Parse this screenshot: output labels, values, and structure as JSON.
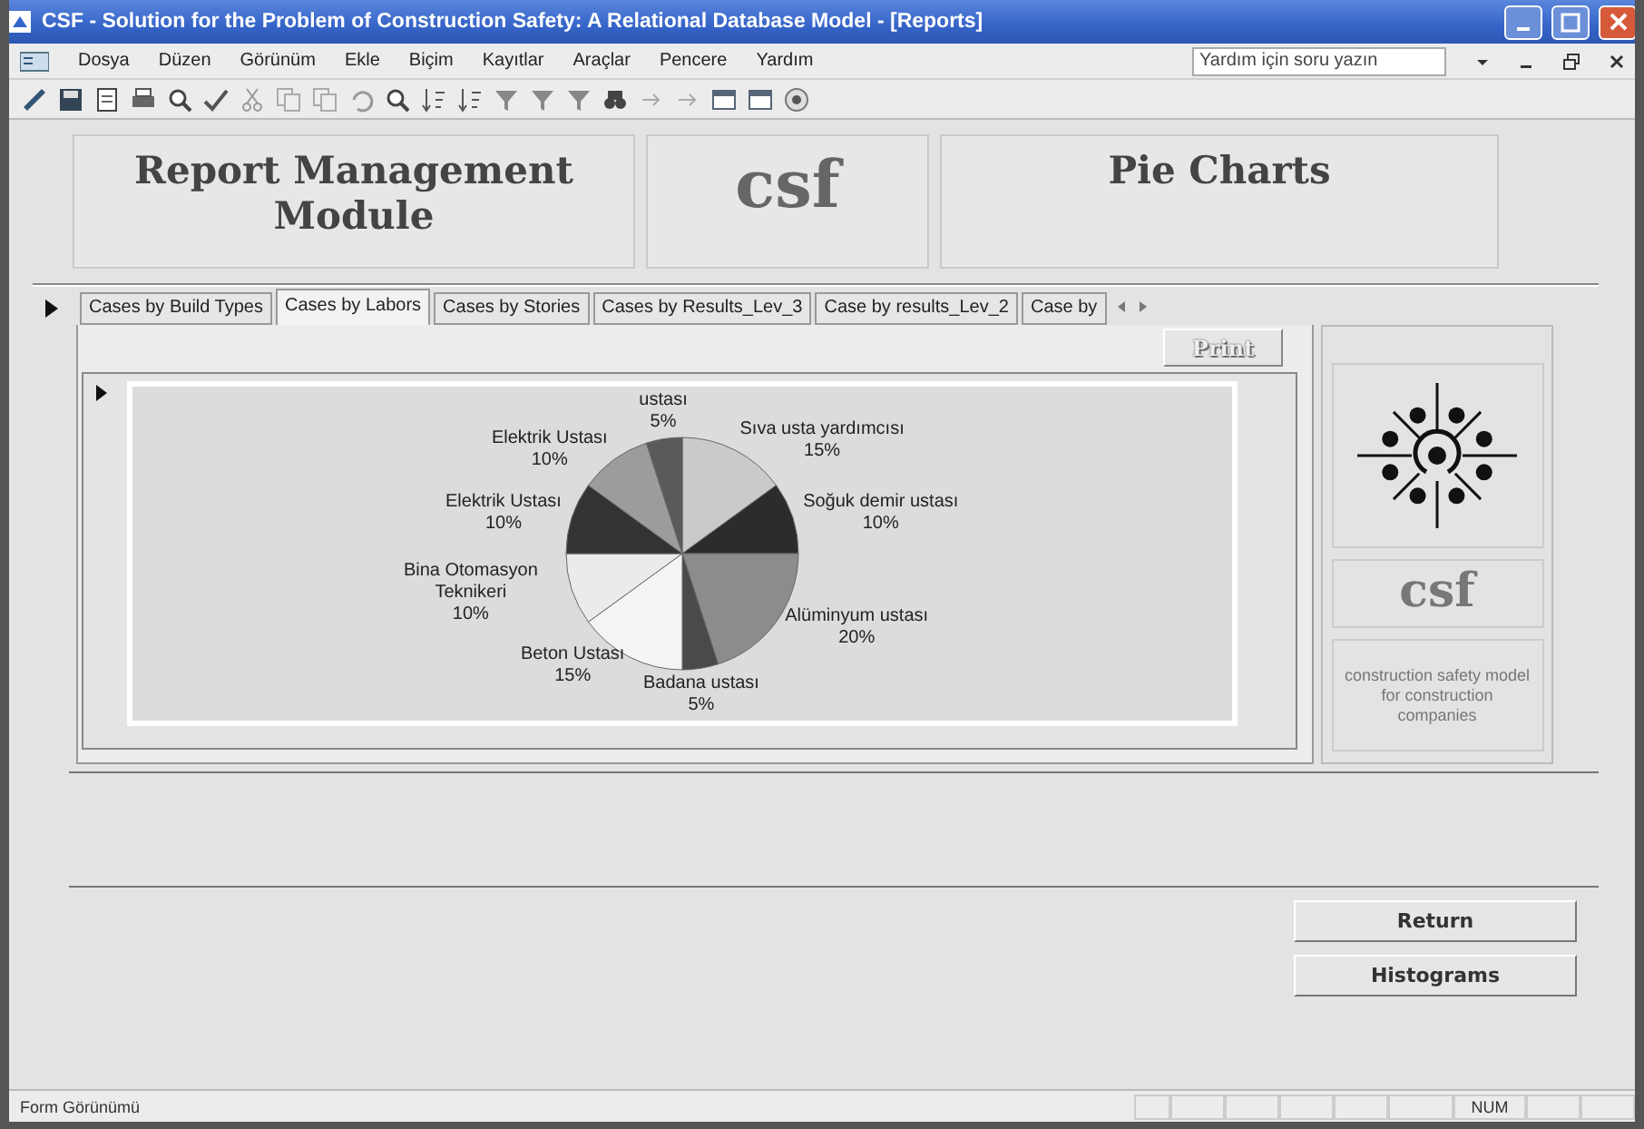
{
  "window": {
    "title": "CSF - Solution for the Problem of Construction Safety: A Relational Database Model - [Reports]"
  },
  "menu": [
    "Dosya",
    "Düzen",
    "Görünüm",
    "Ekle",
    "Biçim",
    "Kayıtlar",
    "Araçlar",
    "Pencere",
    "Yardım"
  ],
  "help_box": {
    "placeholder": "Yardım için soru yazın"
  },
  "header": {
    "module_title": "Report Management Module",
    "logo_text": "csf",
    "page_title": "Pie Charts"
  },
  "tabs": [
    {
      "label": "Cases by Build Types",
      "selected": false
    },
    {
      "label": "Cases by Labors",
      "selected": true
    },
    {
      "label": "Cases by Stories",
      "selected": false
    },
    {
      "label": "Cases by Results_Lev_3",
      "selected": false
    },
    {
      "label": "Case by results_Lev_2",
      "selected": false
    },
    {
      "label": "Case by",
      "selected": false
    }
  ],
  "print_button": "Print",
  "chart_data": {
    "type": "pie",
    "data_labels": true,
    "categories": [
      "Sıva usta yardımcısı",
      "Soğuk demir ustası",
      "Alüminyum ustası",
      "Badana ustası",
      "Beton Ustası",
      "Bina Otomasyon Teknikeri",
      "Elektrik Ustası",
      "Elektrik Ustası",
      "ustası"
    ],
    "values": [
      15,
      10,
      20,
      5,
      15,
      10,
      10,
      10,
      5
    ],
    "value_labels": [
      "15%",
      "10%",
      "20%",
      "5%",
      "15%",
      "10%",
      "10%",
      "10%",
      "5%"
    ]
  },
  "side_panel": {
    "logo_text": "csf",
    "caption": "construction safety model for construction companies"
  },
  "buttons": [
    "Return",
    "Histograms"
  ],
  "status_bar": {
    "text": "Form Görünümü",
    "indicator": "NUM"
  }
}
